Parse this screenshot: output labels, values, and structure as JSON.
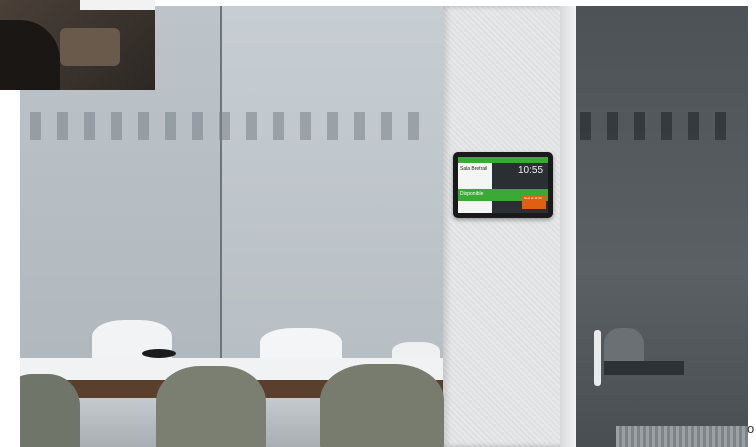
{
  "tablet": {
    "room_name": "Sala Bretrail",
    "clock": "10:55",
    "status": "Disponible",
    "next_meeting": "Next at 11:30"
  },
  "corner_char": "o",
  "colors": {
    "available_green": "#3aa935",
    "next_orange": "#e05f12",
    "pillar": "#e3e4e5",
    "glass": "#bcc4ca"
  }
}
